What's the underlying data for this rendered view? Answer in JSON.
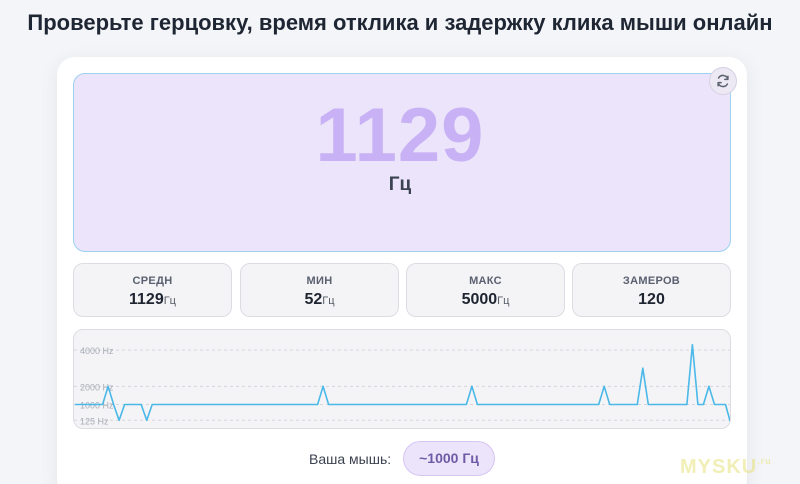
{
  "page": {
    "title": "Проверьте герцовку, время отклика и задержку клика мыши онлайн"
  },
  "hero": {
    "value": "1129",
    "unit": "Гц",
    "refresh_icon": "refresh-icon"
  },
  "stats": [
    {
      "label": "СРЕДН",
      "value": "1129",
      "unit": "Гц"
    },
    {
      "label": "МИН",
      "value": "52",
      "unit": "Гц"
    },
    {
      "label": "МАКС",
      "value": "5000",
      "unit": "Гц"
    },
    {
      "label": "ЗАМЕРОВ",
      "value": "120",
      "unit": ""
    }
  ],
  "chart_data": {
    "type": "line",
    "ytick_labels": [
      "4000 Hz",
      "2000 Hz",
      "1000 Hz",
      "125 Hz"
    ],
    "yticks": [
      4000,
      2000,
      1000,
      125
    ],
    "ylim": [
      -300,
      5000
    ],
    "grid": true,
    "series": [
      {
        "values": [
          1000,
          1000,
          1000,
          1000,
          1000,
          1000,
          2000,
          1000,
          125,
          1000,
          1000,
          1000,
          1000,
          125,
          1000,
          1000,
          1000,
          1000,
          1000,
          1000,
          1000,
          1000,
          1000,
          1000,
          1000,
          1000,
          1000,
          1000,
          1000,
          1000,
          1000,
          1000,
          1000,
          1000,
          1000,
          1000,
          1000,
          1000,
          1000,
          1000,
          1000,
          1000,
          1000,
          1000,
          1000,
          2000,
          1000,
          1000,
          1000,
          1000,
          1000,
          1000,
          1000,
          1000,
          1000,
          1000,
          1000,
          1000,
          1000,
          1000,
          1000,
          1000,
          1000,
          1000,
          1000,
          1000,
          1000,
          1000,
          1000,
          1000,
          1000,
          1000,
          2000,
          1000,
          1000,
          1000,
          1000,
          1000,
          1000,
          1000,
          1000,
          1000,
          1000,
          1000,
          1000,
          1000,
          1000,
          1000,
          1000,
          1000,
          1000,
          1000,
          1000,
          1000,
          1000,
          1000,
          2000,
          1000,
          1000,
          1000,
          1000,
          1000,
          1000,
          3000,
          1000,
          1000,
          1000,
          1000,
          1000,
          1000,
          1000,
          1000,
          4300,
          1000,
          1000,
          2000,
          1000,
          1000,
          1000,
          -100
        ],
        "color": "#4ab8e8"
      }
    ]
  },
  "mouse": {
    "label": "Ваша мышь:",
    "value": "~1000 Гц"
  },
  "watermark": {
    "text": "MYSKU",
    "suffix": ".ru"
  }
}
